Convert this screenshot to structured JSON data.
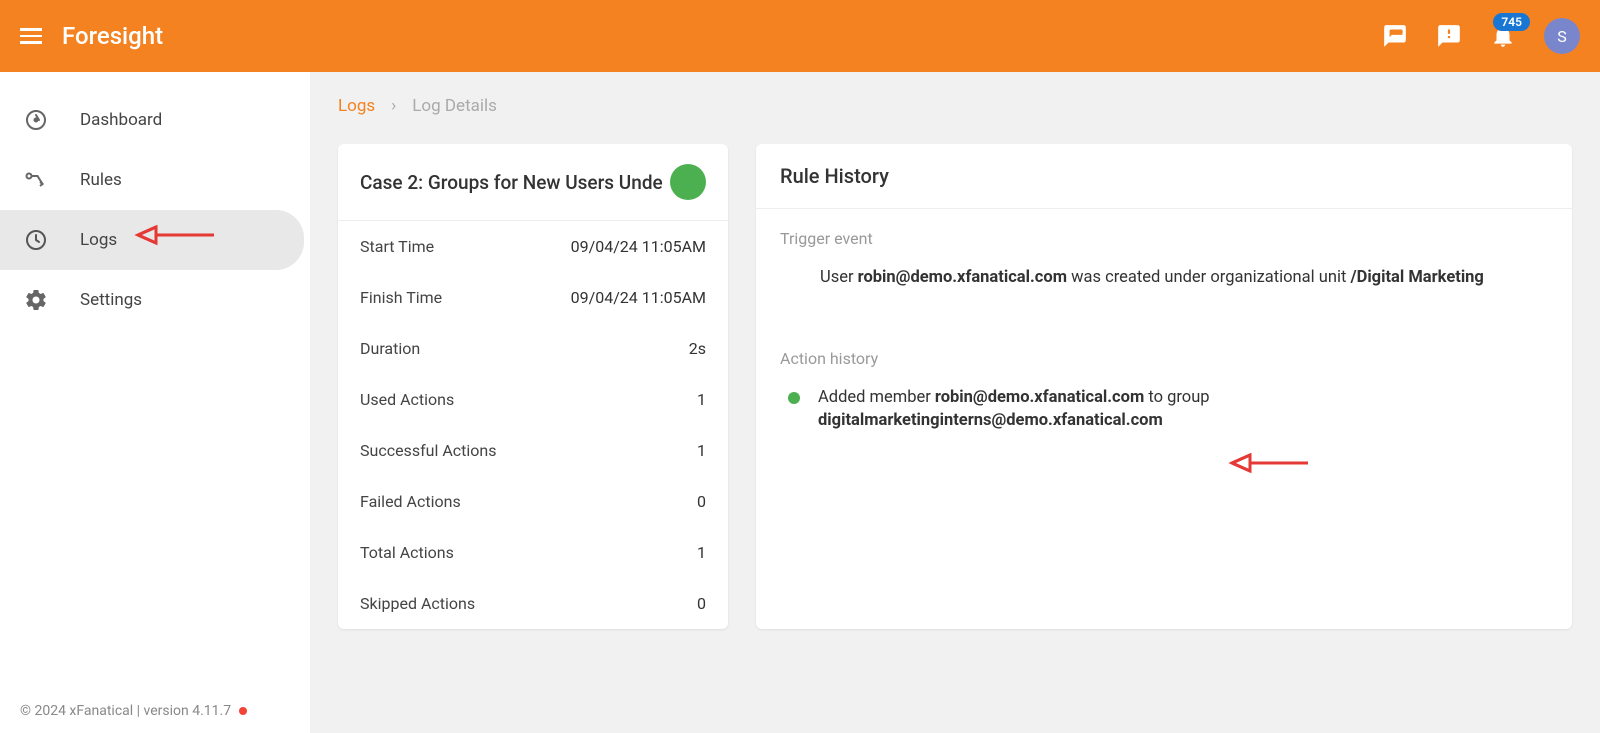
{
  "header": {
    "app_title": "Foresight",
    "badge_count": "745",
    "avatar_initial": "S"
  },
  "sidebar": {
    "items": [
      {
        "label": "Dashboard"
      },
      {
        "label": "Rules"
      },
      {
        "label": "Logs"
      },
      {
        "label": "Settings"
      }
    ],
    "footer_text": "© 2024 xFanatical | version 4.11.7"
  },
  "breadcrumb": {
    "link": "Logs",
    "current": "Log Details"
  },
  "case_card": {
    "title": "Case 2: Groups for New Users Unde",
    "stats": [
      {
        "label": "Start Time",
        "value": "09/04/24 11:05AM"
      },
      {
        "label": "Finish Time",
        "value": "09/04/24 11:05AM"
      },
      {
        "label": "Duration",
        "value": "2s"
      },
      {
        "label": "Used Actions",
        "value": "1"
      },
      {
        "label": "Successful Actions",
        "value": "1"
      },
      {
        "label": "Failed Actions",
        "value": "0"
      },
      {
        "label": "Total Actions",
        "value": "1"
      },
      {
        "label": "Skipped Actions",
        "value": "0"
      }
    ]
  },
  "rule_history": {
    "title": "Rule History",
    "trigger_label": "Trigger event",
    "trigger_text_prefix": "User ",
    "trigger_email": "robin@demo.xfanatical.com",
    "trigger_text_mid": " was created under organizational unit ",
    "trigger_unit": "/Digital Marketing",
    "action_label": "Action history",
    "action_text_prefix": "Added member ",
    "action_email1": "robin@demo.xfanatical.com",
    "action_text_mid": " to group ",
    "action_email2": "digitalmarketinginterns@demo.xfanatical.com"
  }
}
